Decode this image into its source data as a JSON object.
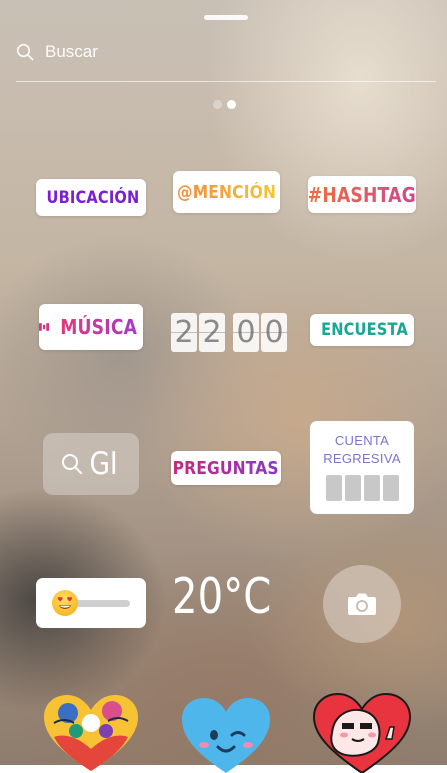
{
  "search": {
    "placeholder": "Buscar"
  },
  "pager": {
    "pages": 2,
    "active_index": 1
  },
  "stickers": {
    "ubicacion": "UBICACIÓN",
    "mencion": "@MENCIÓN",
    "hashtag": "#HASHTAG",
    "musica": "MÚSICA",
    "clock_digits": [
      "2",
      "2",
      "0",
      "0"
    ],
    "encuesta": "ENCUESTA",
    "gif": "GI",
    "preguntas": "PREGUNTAS",
    "countdown_line1": "CUENTA",
    "countdown_line2": "REGRESIVA",
    "slider_emoji": "heart-eyes-emoji",
    "temperature": "20°C",
    "camera": "camera-icon"
  },
  "colors": {
    "ubicacion": "#7a1fd1",
    "encuesta": "#18a793",
    "countdown": "#7c74c9",
    "musica_start": "#e3377a",
    "musica_end": "#a23cc7"
  }
}
